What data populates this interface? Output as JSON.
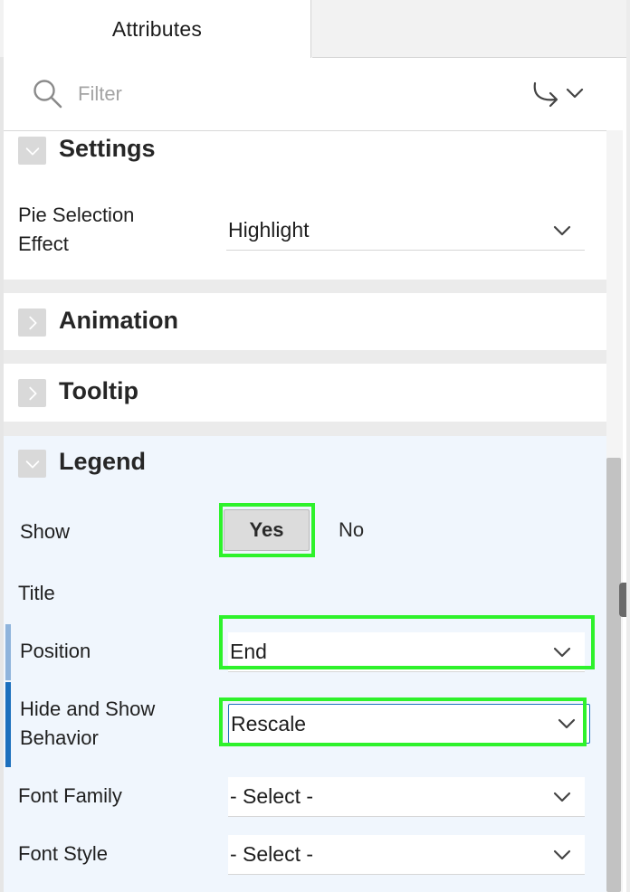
{
  "tabs": {
    "active_label": "Attributes"
  },
  "filter": {
    "placeholder": "Filter"
  },
  "sections": {
    "settings": {
      "title": "Settings",
      "pie_selection_effect": {
        "label": "Pie Selection\nEffect",
        "value": "Highlight"
      }
    },
    "animation": {
      "title": "Animation"
    },
    "tooltip": {
      "title": "Tooltip"
    },
    "legend": {
      "title": "Legend",
      "show": {
        "label": "Show",
        "yes": "Yes",
        "no": "No",
        "selected": "Yes"
      },
      "title_field": {
        "label": "Title"
      },
      "position": {
        "label": "Position",
        "value": "End"
      },
      "hide_show": {
        "label": "Hide and Show\nBehavior",
        "value": "Rescale"
      },
      "font_family": {
        "label": "Font Family",
        "value": "- Select -"
      },
      "font_style": {
        "label": "Font Style",
        "value": "- Select -"
      }
    }
  },
  "colors": {
    "highlight": "#2ef22b",
    "legend_bg": "#f0f6fd",
    "accent_marker": "#1c6fbd"
  },
  "icons": [
    "search-icon",
    "go-to-icon",
    "chevron-down-icon",
    "chevron-right-icon"
  ]
}
